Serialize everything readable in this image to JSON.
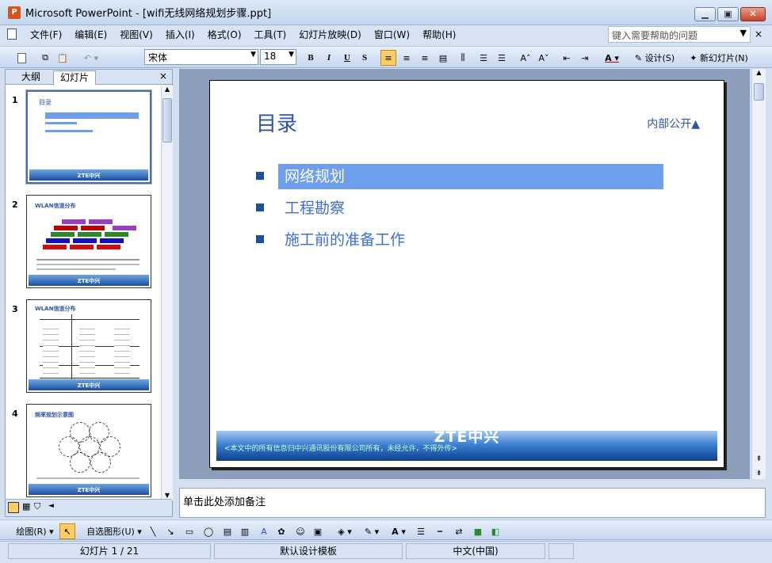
{
  "window": {
    "title": "Microsoft PowerPoint - [wifi无线网络规划步骤.ppt]",
    "minimize": "▁",
    "restore": "▣",
    "close": "✕"
  },
  "menu": {
    "items": [
      "文件(F)",
      "编辑(E)",
      "视图(V)",
      "插入(I)",
      "格式(O)",
      "工具(T)",
      "幻灯片放映(D)",
      "窗口(W)",
      "帮助(H)"
    ],
    "help_placeholder": "键入需要帮助的问题"
  },
  "toolbar": {
    "font": "宋体",
    "size": "18",
    "bold": "B",
    "italic": "I",
    "underline": "U",
    "shadow": "S",
    "font_color": "A",
    "design": "设计(S)",
    "new_slide": "新幻灯片(N)"
  },
  "panel": {
    "tabs": [
      "大纲",
      "幻灯片"
    ],
    "close": "×",
    "thumbs": [
      {
        "num": "1",
        "title": "目录",
        "logo": "ZTE中兴"
      },
      {
        "num": "2",
        "title": "WLAN信道分布",
        "logo": "ZTE中兴"
      },
      {
        "num": "3",
        "title": "WLAN信道分布",
        "logo": "ZTE中兴"
      },
      {
        "num": "4",
        "title": "频率规划示意图",
        "logo": "ZTE中兴"
      }
    ]
  },
  "slide": {
    "title": "目录",
    "tag": "内部公开▲",
    "bullets": [
      "网络规划",
      "工程勘察",
      "施工前的准备工作"
    ],
    "logo": "ZTE中兴",
    "footer": "<本文中的所有信息归中兴通讯股份有限公司所有，未经允许，不得外传>"
  },
  "notes": {
    "placeholder": "单击此处添加备注"
  },
  "drawbar": {
    "draw": "绘图(R)",
    "autoshapes": "自选图形(U)"
  },
  "status": {
    "slide": "幻灯片 1 / 21",
    "template": "默认设计模板",
    "language": "中文(中国)"
  },
  "colors": {
    "accent": "#2d56a8",
    "highlight": "#6e9fec",
    "bullet": "#1f4fa3"
  }
}
